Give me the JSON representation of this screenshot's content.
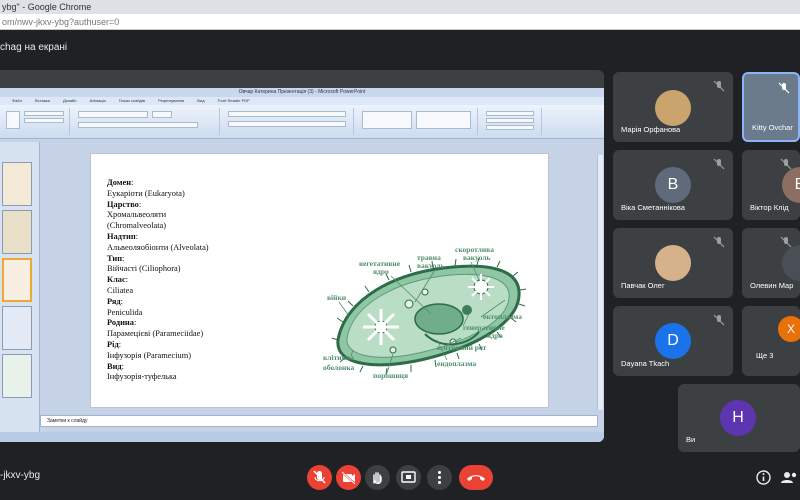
{
  "browser": {
    "window_title": "ybg\" - Google Chrome",
    "url": "om/nwv-jkxv-ybg?authuser=0"
  },
  "meet": {
    "presenting_label": "chag на екрані",
    "meeting_code": "-jkxv-ybg"
  },
  "powerpoint": {
    "window_title": "Овчар Катерина Презентація (3) - Microsoft PowerPoint",
    "menu": [
      "Файл",
      "Вставка",
      "Дизайн",
      "Анімація",
      "Показ слайдів",
      "Рецензування",
      "Вид",
      "Foxit Reader PDF"
    ],
    "notes_placeholder": "Заметки к слайду"
  },
  "slide": {
    "lines": [
      {
        "label": "Домен",
        "text": ":"
      },
      {
        "label": "",
        "text": "Еукаріоти (Eukaryota)"
      },
      {
        "label": "Царство",
        "text": ":"
      },
      {
        "label": "",
        "text": "Хромальвеоляти"
      },
      {
        "label": "",
        "text": "(Chromalveolata)"
      },
      {
        "label": "Надтип",
        "text": ":"
      },
      {
        "label": "",
        "text": "Альвеоляобіонти (Alveolata)"
      },
      {
        "label": "Тип",
        "text": ":"
      },
      {
        "label": "",
        "text": "Війчасті (Ciliophora)"
      },
      {
        "label": "Клас",
        "text": ":"
      },
      {
        "label": "",
        "text": "Ciliatea"
      },
      {
        "label": "Ряд",
        "text": ":"
      },
      {
        "label": "",
        "text": "Peniculida"
      },
      {
        "label": "Родина",
        "text": ":"
      },
      {
        "label": "",
        "text": "Парамецієві (Parameciidae)"
      },
      {
        "label": "Рід",
        "text": ":"
      },
      {
        "label": "",
        "text": "Інфузорія (Paramecium)"
      },
      {
        "label": "Вид",
        "text": ":"
      },
      {
        "label": "",
        "text": "Інфузорія-туфелька"
      }
    ],
    "diagram_labels": {
      "vegetative_nucleus": "вегетативне ядро",
      "digestive_vacuole": "травна вакуоль",
      "contractile_vacuole": "скоротлива вакуоль",
      "cilia": "війки",
      "ectoplasm": "ектоплазма",
      "generative_nucleus": "генеративне ядро",
      "cell_mouth": "клітинний рот",
      "endoplasm": "ендоплазма",
      "cell_membrane": "клітинна оболонка",
      "powder": "порошиця"
    }
  },
  "participants": [
    {
      "name": "Марія Орфанова",
      "avatar": "photo",
      "color": "#c9a46c"
    },
    {
      "name": "Kitty Ovchar",
      "avatar": "photo",
      "color": "#a7b6c8"
    },
    {
      "name": "Віка Сметаннікова",
      "avatar": "B",
      "color": "#5f6b7a"
    },
    {
      "name": "Віктор Клід",
      "avatar": "B",
      "color": "#8d6e63"
    },
    {
      "name": "Павчак Олег",
      "avatar": "photo",
      "color": "#d6b28a"
    },
    {
      "name": "Олевин Мар",
      "avatar": "photo",
      "color": "#4a4f56"
    },
    {
      "name": "Dayana Tkach",
      "avatar": "D",
      "color": "#1a73e8"
    },
    {
      "name": "Ще 3",
      "avatar": "X",
      "color": "#e8710a"
    },
    {
      "name": "Ви",
      "avatar": "H",
      "color": "#5e35b1"
    }
  ],
  "colors": {
    "meet_bg": "#202124",
    "tile_bg": "#3c4043",
    "end_call": "#ea4335",
    "slide_diagram_green": "#4f8f6b"
  },
  "icons": [
    "mic-off-icon",
    "camera-off-icon",
    "raise-hand-icon",
    "present-icon",
    "more-options-icon",
    "end-call-icon",
    "info-icon",
    "people-icon"
  ]
}
